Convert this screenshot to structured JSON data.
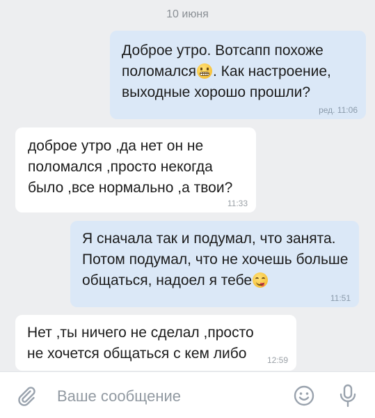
{
  "chat": {
    "date_separator": "10 июня",
    "messages": [
      {
        "direction": "outgoing",
        "text_before_emoji": "Доброе утро. Вотсапп похоже поломался",
        "emoji": "grimacing-face-emoji",
        "text_after_emoji": ". Как настроение, выходные хорошо прошли?",
        "meta": "ред. 11:06"
      },
      {
        "direction": "incoming",
        "text": "доброе утро ,да нет он не поломался ,просто некогда было ,все нормально ,а твои?",
        "meta": "11:33"
      },
      {
        "direction": "outgoing",
        "text_before_emoji": "Я сначала так и подумал, что занята. Потом подумал, что не хочешь больше общаться, надоел я тебе",
        "emoji": "savoring-face-emoji",
        "text_after_emoji": "",
        "meta": "11:51"
      },
      {
        "direction": "incoming",
        "text": "Нет ,ты ничего не сделал ,просто не хочется общаться с кем либо",
        "meta": "12:59"
      }
    ]
  },
  "composer": {
    "placeholder": "Ваше сообщение",
    "value": "",
    "icons": [
      "paperclip-icon",
      "smile-icon",
      "microphone-icon"
    ]
  },
  "colors": {
    "background": "#edeef0",
    "outgoing_bubble": "#dbe8f7",
    "incoming_bubble": "#ffffff",
    "icon_gray": "#99a2ad"
  }
}
